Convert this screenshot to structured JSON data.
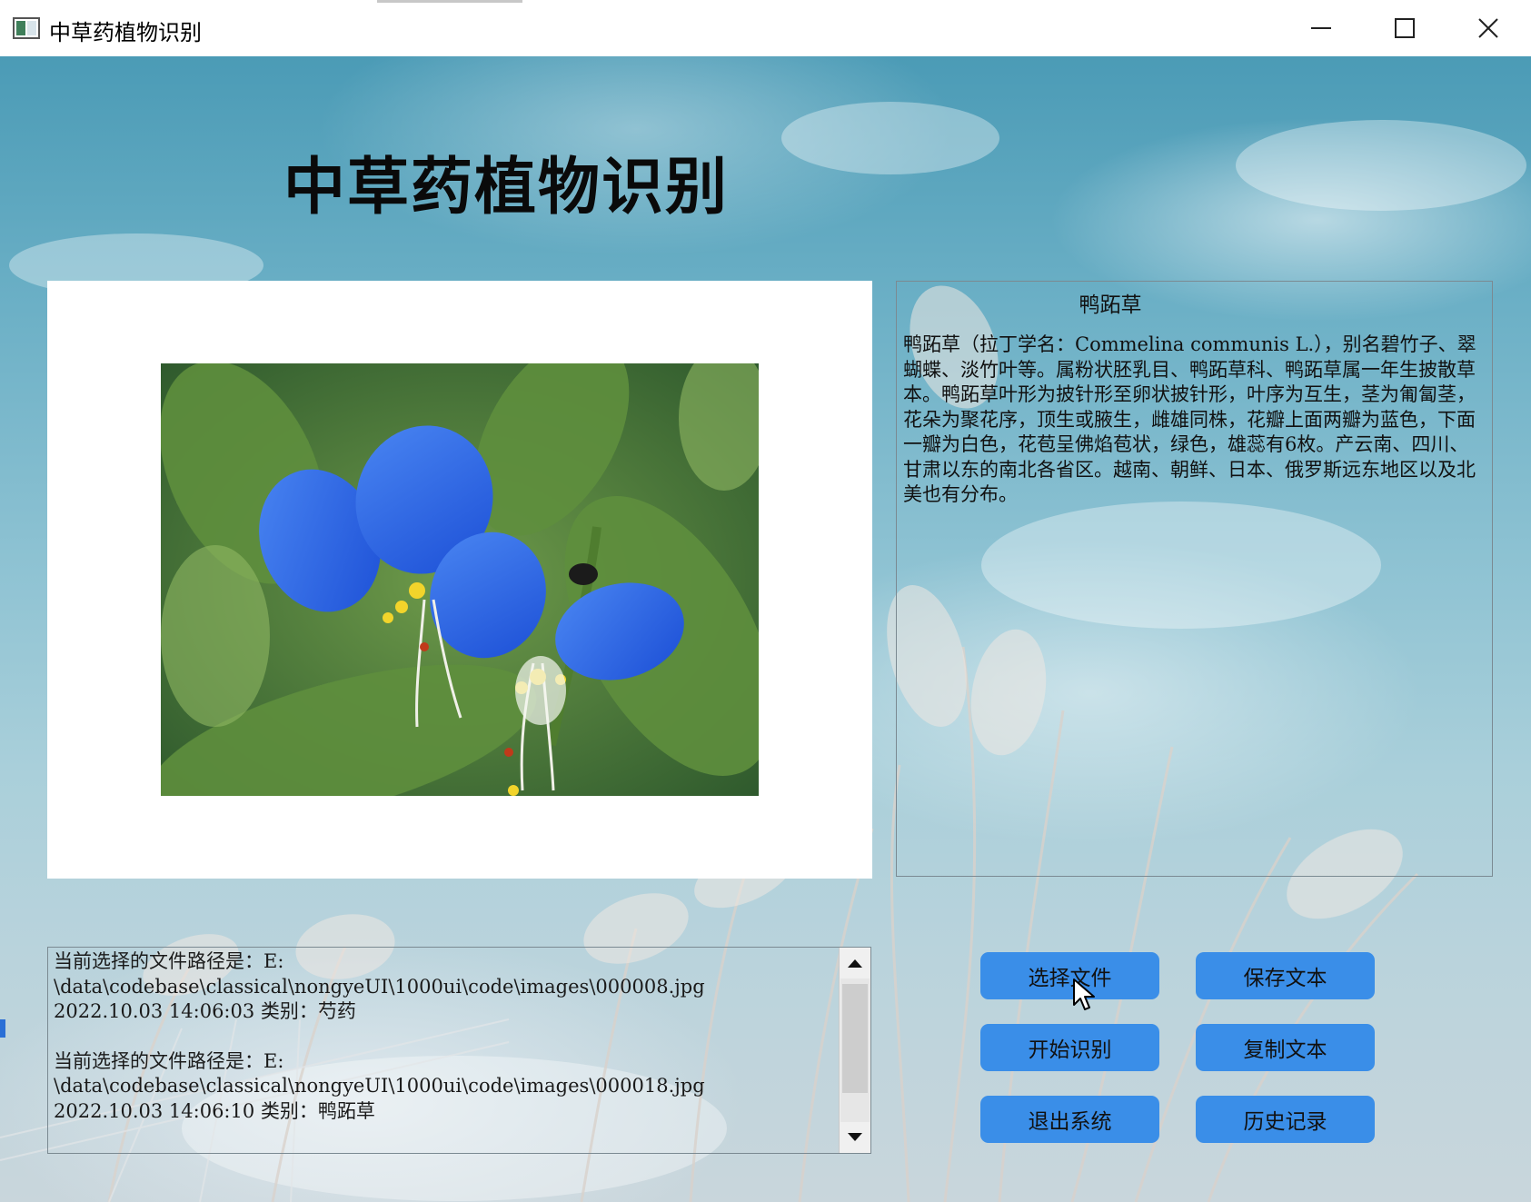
{
  "window": {
    "title": "中草药植物识别",
    "controls": [
      "minimize",
      "maximize",
      "close"
    ]
  },
  "app": {
    "heading": "中草药植物识别"
  },
  "image_panel": {
    "image_subject": "鸭跖草"
  },
  "description": {
    "title": "鸭跖草",
    "body": "鸭跖草（拉丁学名：Commelina communis L.），别名碧竹子、翠蝴蝶、淡竹叶等。属粉状胚乳目、鸭跖草科、鸭跖草属一年生披散草本。鸭跖草叶形为披针形至卵状披针形，叶序为互生，茎为匍匐茎，花朵为聚花序，顶生或腋生，雌雄同株，花瓣上面两瓣为蓝色，下面一瓣为白色，花苞呈佛焰苞状，绿色，雄蕊有6枚。产云南、四川、甘肃以东的南北各省区。越南、朝鲜、日本、俄罗斯远东地区以及北美也有分布。"
  },
  "log": {
    "entries": [
      {
        "path_line1": "当前选择的文件路径是：E:",
        "path_line2": "\\data\\codebase\\classical\\nongyeUI\\1000ui\\code\\images\\000008.jpg",
        "result_line": "2022.10.03 14:06:03 类别：芍药"
      },
      {
        "path_line1": "当前选择的文件路径是：E:",
        "path_line2": "\\data\\codebase\\classical\\nongyeUI\\1000ui\\code\\images\\000018.jpg",
        "result_line": "2022.10.03 14:06:10 类别：鸭跖草"
      }
    ]
  },
  "buttons": {
    "select_file": "选择文件",
    "save_text": "保存文本",
    "start_recognition": "开始识别",
    "copy_text": "复制文本",
    "exit_system": "退出系统",
    "history": "历史记录"
  },
  "colors": {
    "button_bg": "#3a8ee8",
    "panel_bg": "#ffffff",
    "title_bar_bg": "#ffffff"
  }
}
